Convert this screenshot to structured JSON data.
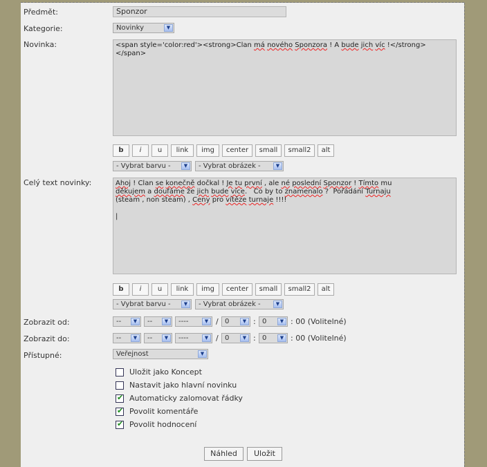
{
  "form": {
    "subject_label": "Předmět:",
    "subject_value": "Sponzor",
    "category_label": "Kategorie:",
    "category_value": "Novinky",
    "news_label": "Novinka:",
    "news_text_parts": [
      "<span style='color:red'><strong>Clan ",
      "má",
      " ",
      "nového",
      " ",
      "Sponzora",
      " ! A ",
      "bude",
      " ",
      "jich",
      " ",
      "víc",
      " !</strong>\n</span>"
    ],
    "full_label": "Celý text novinky:",
    "full_text_parts": [
      "Ahoj",
      " ! Clan ",
      "se",
      " ",
      "konečně",
      " dočkal ! ",
      "Je",
      " ",
      "tu",
      " ",
      "první",
      " , ale ",
      "né",
      " ",
      "poslední",
      " ",
      "Sponzor",
      " ! ",
      "Tímto",
      " mu\n",
      "děkujem",
      " a ",
      "doufáme",
      " že ",
      "jich",
      " ",
      "bude",
      " ",
      "více",
      ".   Co by to ",
      "znamenalo",
      " ?  Pořádání ",
      "Turnaju",
      "\n(steam , non steam) , ",
      "Ceny",
      " pro ",
      "vítěze",
      " ",
      "turnaje",
      " !!!!\n\n|"
    ],
    "show_from_label": "Zobrazit od:",
    "show_to_label": "Zobrazit do:",
    "access_label": "Přístupné:",
    "access_value": "Veřejnost"
  },
  "format_buttons": [
    "b",
    "i",
    "u",
    "link",
    "img",
    "center",
    "small",
    "small2",
    "alt"
  ],
  "color_select": "- Vybrat barvu -",
  "image_select": "- Vybrat obrázek -",
  "date": {
    "day": "--",
    "month": "--",
    "year": "----",
    "hour": "0",
    "minute": "0",
    "slash": "/",
    "colon": ":",
    "suffix": ": 00 (Volitelné)"
  },
  "options": [
    {
      "label": "Uložit jako Koncept",
      "checked": false
    },
    {
      "label": "Nastavit jako hlavní novinku",
      "checked": false
    },
    {
      "label": "Automaticky zalomovat řádky",
      "checked": true
    },
    {
      "label": "Povolit komentáře",
      "checked": true
    },
    {
      "label": "Povolit hodnocení",
      "checked": true
    }
  ],
  "actions": {
    "preview": "Náhled",
    "save": "Uložit"
  },
  "misspelled_news": [
    1,
    3,
    5,
    7,
    9,
    11
  ],
  "misspelled_full": [
    0,
    2,
    4,
    6,
    8,
    10,
    12,
    14,
    16,
    18,
    20,
    22,
    24,
    26,
    28,
    30,
    32,
    34,
    36,
    38
  ]
}
